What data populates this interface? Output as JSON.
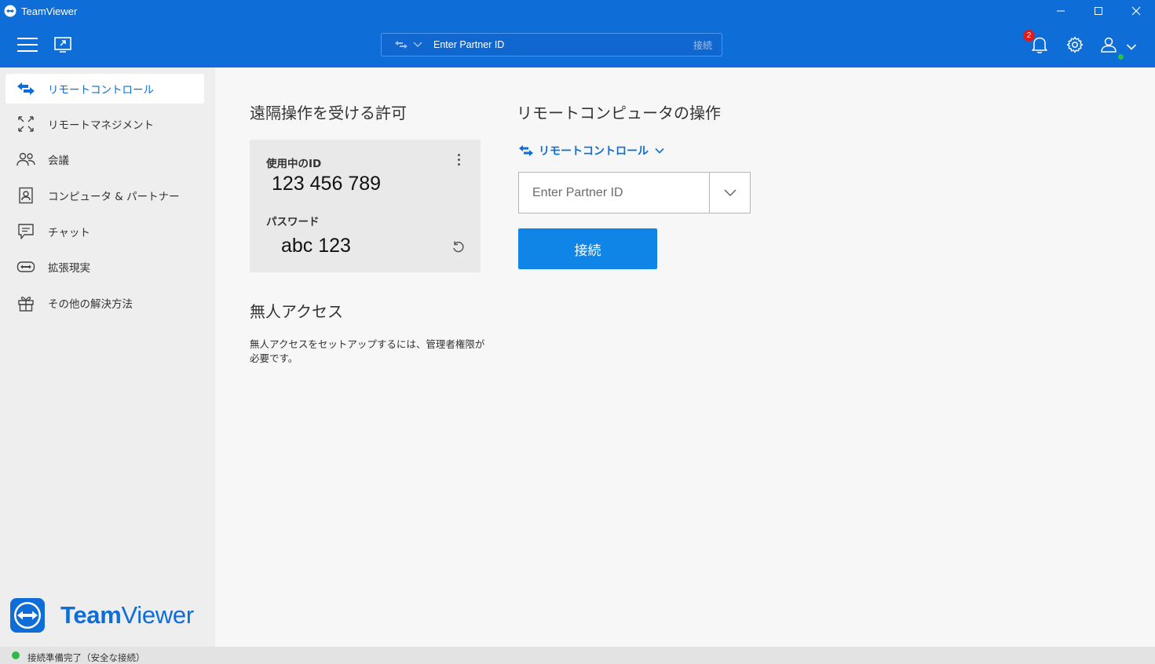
{
  "window": {
    "title": "TeamViewer"
  },
  "header": {
    "quick_connect_placeholder": "Enter Partner ID",
    "quick_connect_button": "接続",
    "notification_count": "2"
  },
  "sidebar": {
    "items": [
      {
        "label": "リモートコントロール",
        "icon": "remote-control-arrows-icon",
        "active": true
      },
      {
        "label": "リモートマネジメント",
        "icon": "remote-management-icon",
        "active": false
      },
      {
        "label": "会議",
        "icon": "meeting-people-icon",
        "active": false
      },
      {
        "label": "コンピュータ & パートナー",
        "icon": "contacts-icon",
        "active": false
      },
      {
        "label": "チャット",
        "icon": "chat-icon",
        "active": false
      },
      {
        "label": "拡張現実",
        "icon": "augmented-reality-icon",
        "active": false
      },
      {
        "label": "その他の解決方法",
        "icon": "gift-icon",
        "active": false
      }
    ],
    "brand_team": "Team",
    "brand_viewer": "Viewer"
  },
  "allow": {
    "title": "遠隔操作を受ける許可",
    "id_label": "使用中のID",
    "id_value": "123 456 789",
    "password_label": "パスワード",
    "password_value": "abc 123"
  },
  "unattended": {
    "title": "無人アクセス",
    "description": "無人アクセスをセットアップするには、管理者権限が必要です。"
  },
  "control": {
    "title": "リモートコンピュータの操作",
    "mode_label": "リモートコントロール",
    "partner_placeholder": "Enter Partner ID",
    "connect_label": "接続"
  },
  "status": {
    "text": "接続準備完了（安全な接続）"
  },
  "colors": {
    "brand_blue": "#0e6dd6",
    "button_blue": "#1085e8",
    "status_green": "#2eb84b",
    "badge_red": "#e01b1b"
  }
}
